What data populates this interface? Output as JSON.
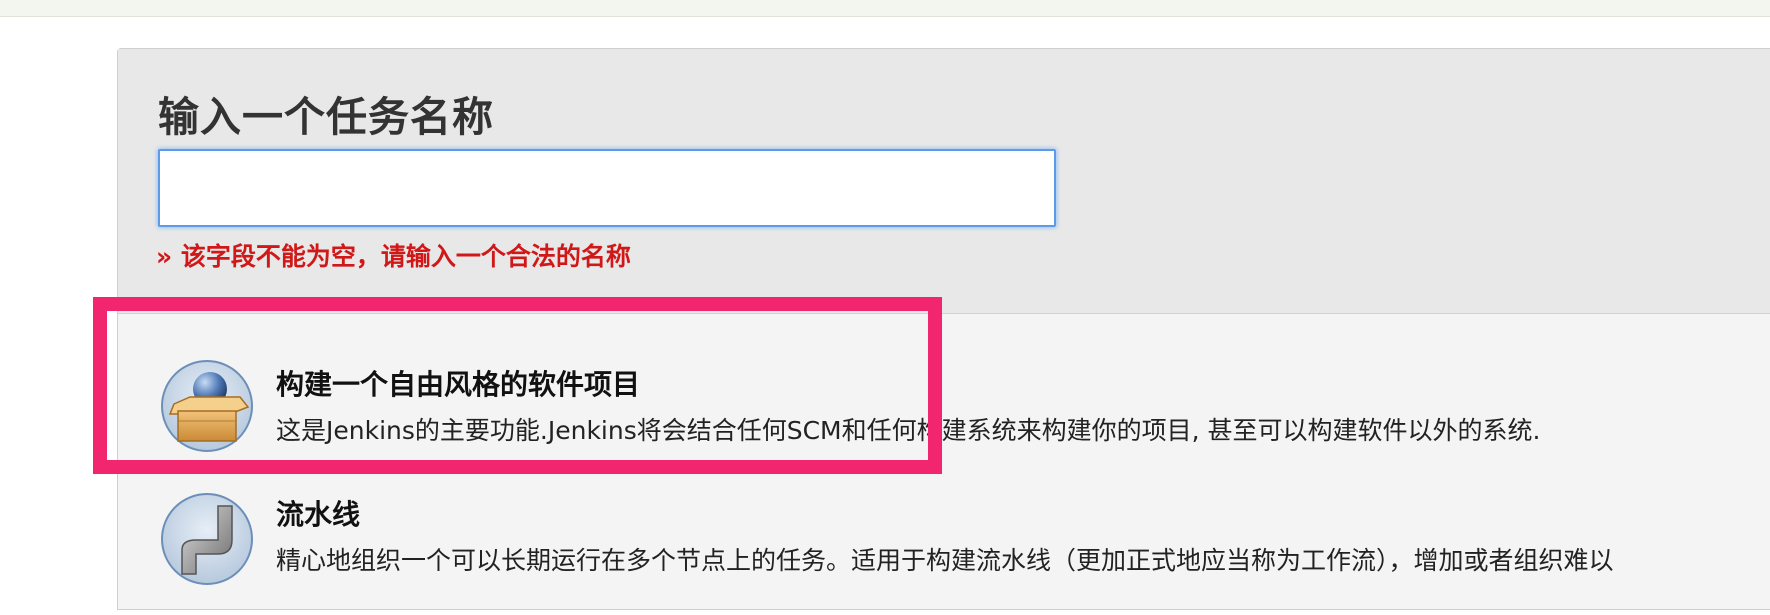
{
  "form": {
    "name_label": "输入一个任务名称",
    "name_value": "",
    "error_message": "» 该字段不能为空，请输入一个合法的名称"
  },
  "job_types": [
    {
      "title": "构建一个自由风格的软件项目",
      "description": "这是Jenkins的主要功能.Jenkins将会结合任何SCM和任何构建系统来构建你的项目, 甚至可以构建软件以外的系统.",
      "icon": "freestyle-box-icon"
    },
    {
      "title": "流水线",
      "description": "精心地组织一个可以长期运行在多个节点上的任务。适用于构建流水线（更加正式地应当称为工作流），增加或者组织难以",
      "icon": "pipeline-icon"
    }
  ],
  "colors": {
    "highlight": "#f2266f",
    "error": "#d01818",
    "input_focus": "#5b9be8"
  }
}
